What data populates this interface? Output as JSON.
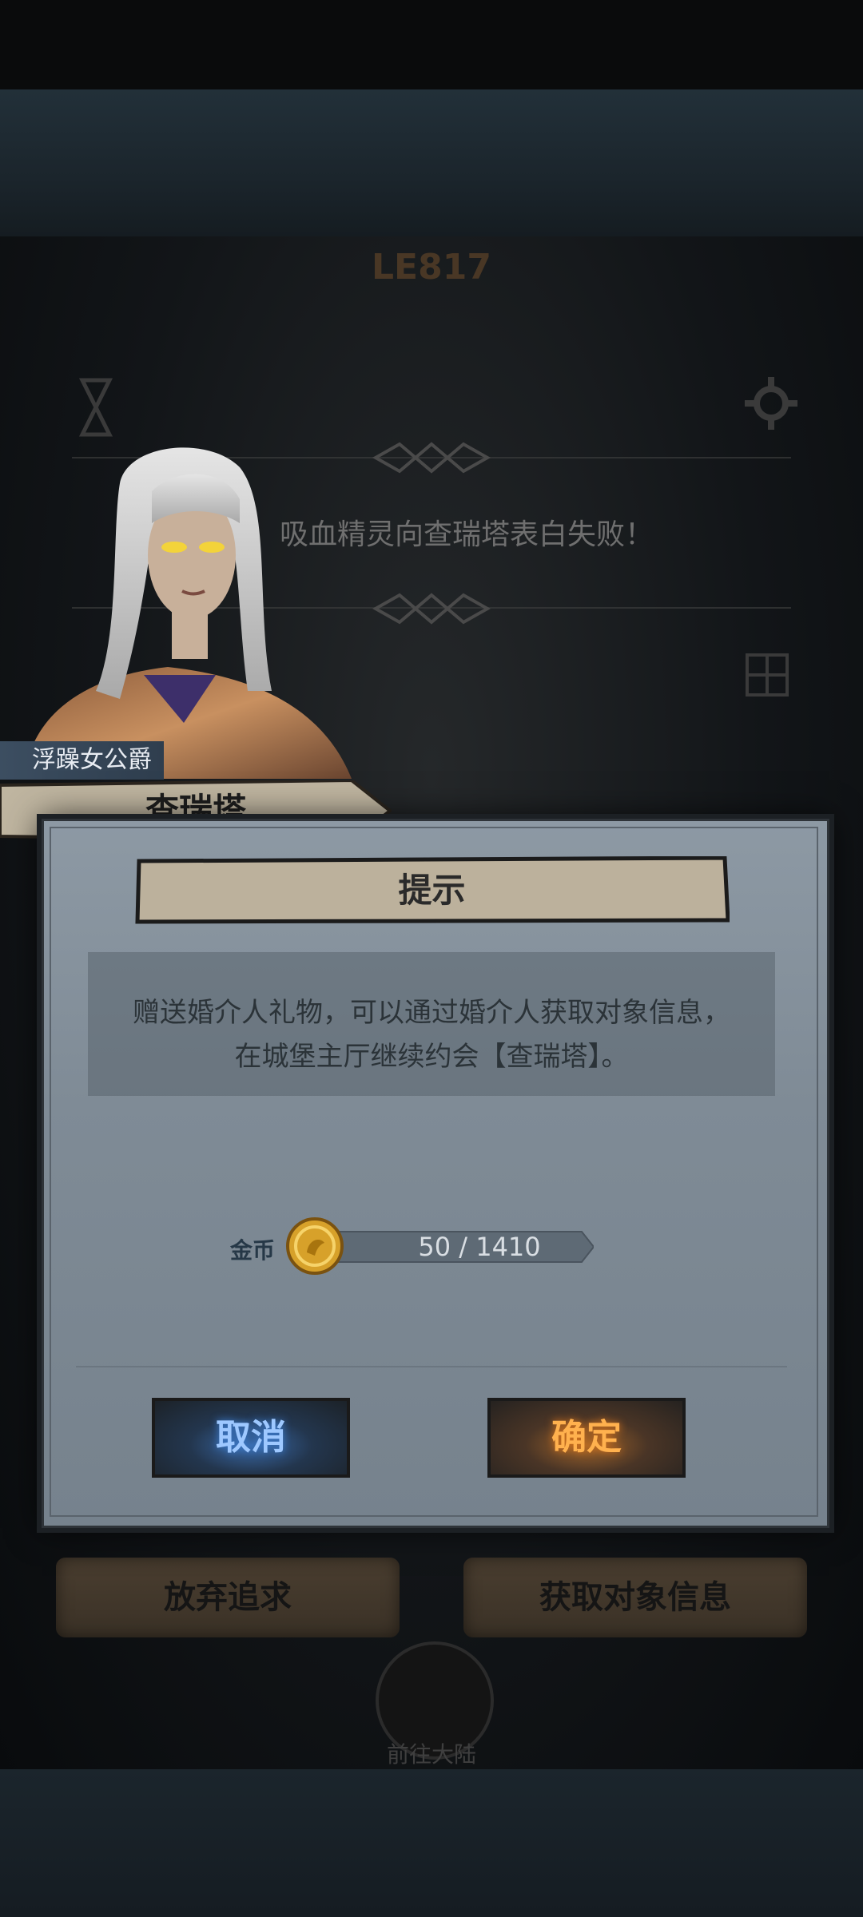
{
  "background": {
    "level_badge": "LE817",
    "message": "吸血精灵向查瑞塔表白失败！"
  },
  "actions": {
    "give_up_label": "放弃追求",
    "get_info_label": "获取对象信息",
    "nav_label": "前往大陆"
  },
  "character": {
    "title": "浮躁女公爵",
    "name": "查瑞塔"
  },
  "dialog": {
    "title": "提示",
    "message_line1": "赠送婚介人礼物，可以通过婚介人获取对象信息，",
    "message_line2": "在城堡主厅继续约会【查瑞塔】。",
    "currency_label": "金币",
    "currency_value": "50 / 1410",
    "cancel_label": "取消",
    "confirm_label": "确定"
  },
  "colors": {
    "cancel_text": "#9ec8ff",
    "confirm_text": "#ffb14e",
    "dialog_bg": "#8d99a4"
  }
}
